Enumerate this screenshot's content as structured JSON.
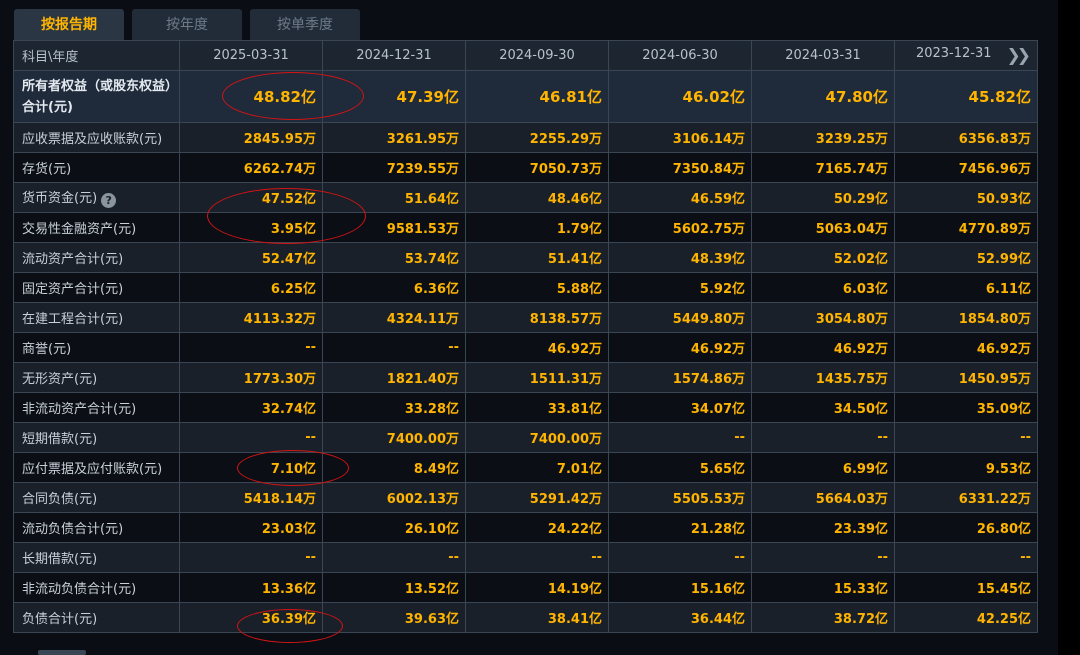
{
  "tabs": [
    {
      "label": "按报告期",
      "active": true
    },
    {
      "label": "按年度",
      "active": false
    },
    {
      "label": "按单季度",
      "active": false
    }
  ],
  "header": {
    "label": "科目\\年度",
    "dates": [
      "2025-03-31",
      "2024-12-31",
      "2024-09-30",
      "2024-06-30",
      "2024-03-31",
      "2023-12-31"
    ],
    "next_icon": "double-chevron-right-icon"
  },
  "rows": [
    {
      "label": "所有者权益（或股东权益）合计(元)",
      "values": [
        "48.82亿",
        "47.39亿",
        "46.81亿",
        "46.02亿",
        "47.80亿",
        "45.82亿"
      ]
    },
    {
      "label": "应收票据及应收账款(元)",
      "values": [
        "2845.95万",
        "3261.95万",
        "2255.29万",
        "3106.14万",
        "3239.25万",
        "6356.83万"
      ]
    },
    {
      "label": "存货(元)",
      "values": [
        "6262.74万",
        "7239.55万",
        "7050.73万",
        "7350.84万",
        "7165.74万",
        "7456.96万"
      ]
    },
    {
      "label": "货币资金(元)",
      "values": [
        "47.52亿",
        "51.64亿",
        "48.46亿",
        "46.59亿",
        "50.29亿",
        "50.93亿"
      ],
      "help_icon": "?"
    },
    {
      "label": "交易性金融资产(元)",
      "values": [
        "3.95亿",
        "9581.53万",
        "1.79亿",
        "5602.75万",
        "5063.04万",
        "4770.89万"
      ]
    },
    {
      "label": "流动资产合计(元)",
      "values": [
        "52.47亿",
        "53.74亿",
        "51.41亿",
        "48.39亿",
        "52.02亿",
        "52.99亿"
      ]
    },
    {
      "label": "固定资产合计(元)",
      "values": [
        "6.25亿",
        "6.36亿",
        "5.88亿",
        "5.92亿",
        "6.03亿",
        "6.11亿"
      ]
    },
    {
      "label": "在建工程合计(元)",
      "values": [
        "4113.32万",
        "4324.11万",
        "8138.57万",
        "5449.80万",
        "3054.80万",
        "1854.80万"
      ]
    },
    {
      "label": "商誉(元)",
      "values": [
        "--",
        "--",
        "46.92万",
        "46.92万",
        "46.92万",
        "46.92万"
      ]
    },
    {
      "label": "无形资产(元)",
      "values": [
        "1773.30万",
        "1821.40万",
        "1511.31万",
        "1574.86万",
        "1435.75万",
        "1450.95万"
      ]
    },
    {
      "label": "非流动资产合计(元)",
      "values": [
        "32.74亿",
        "33.28亿",
        "33.81亿",
        "34.07亿",
        "34.50亿",
        "35.09亿"
      ]
    },
    {
      "label": "短期借款(元)",
      "values": [
        "--",
        "7400.00万",
        "7400.00万",
        "--",
        "--",
        "--"
      ]
    },
    {
      "label": "应付票据及应付账款(元)",
      "values": [
        "7.10亿",
        "8.49亿",
        "7.01亿",
        "5.65亿",
        "6.99亿",
        "9.53亿"
      ]
    },
    {
      "label": "合同负债(元)",
      "values": [
        "5418.14万",
        "6002.13万",
        "5291.42万",
        "5505.53万",
        "5664.03万",
        "6331.22万"
      ]
    },
    {
      "label": "流动负债合计(元)",
      "values": [
        "23.03亿",
        "26.10亿",
        "24.22亿",
        "21.28亿",
        "23.39亿",
        "26.80亿"
      ]
    },
    {
      "label": "长期借款(元)",
      "values": [
        "--",
        "--",
        "--",
        "--",
        "--",
        "--"
      ]
    },
    {
      "label": "非流动负债合计(元)",
      "values": [
        "13.36亿",
        "13.52亿",
        "14.19亿",
        "15.16亿",
        "15.33亿",
        "15.45亿"
      ]
    },
    {
      "label": "负债合计(元)",
      "values": [
        "36.39亿",
        "39.63亿",
        "38.41亿",
        "36.44亿",
        "38.72亿",
        "42.25亿"
      ]
    }
  ],
  "colors": {
    "value": "#ffb400",
    "annotation": "#d41414",
    "header_bg": "#1c2530"
  }
}
